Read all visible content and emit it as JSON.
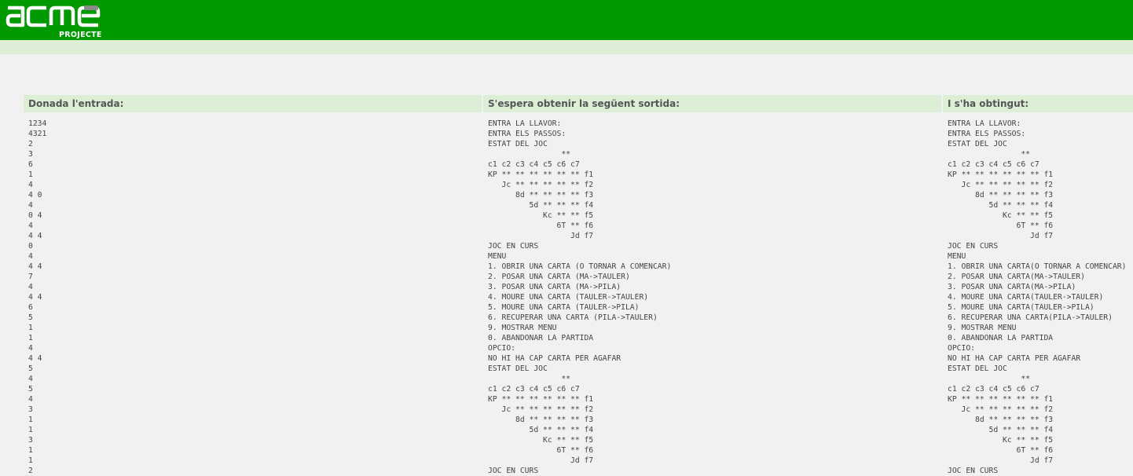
{
  "header": {
    "logo_text": "acme",
    "logo_subtitle": "PROJECTE"
  },
  "columns": {
    "input": {
      "title": "Donada l'entrada:",
      "lines": [
        "1234",
        "4321",
        "2",
        "3",
        "6",
        "1",
        "4",
        "4 0",
        "4",
        "0 4",
        "4",
        "4 4",
        "0",
        "4",
        "4 4",
        "7",
        "4",
        "4 4",
        "6",
        "5",
        "1",
        "1",
        "4",
        "4 4",
        "5",
        "4",
        "5",
        "4",
        "3",
        "1",
        "1",
        "3",
        "1",
        "1",
        "2"
      ]
    },
    "expected": {
      "title": "S'espera obtenir la següent sortida:",
      "lines": [
        "ENTRA LA LLAVOR:",
        "ENTRA ELS PASSOS:",
        "ESTAT DEL JOC",
        "                **",
        "c1 c2 c3 c4 c5 c6 c7",
        "KP ** ** ** ** ** ** f1",
        "   Jc ** ** ** ** ** f2",
        "      8d ** ** ** ** f3",
        "         5d ** ** ** f4",
        "            Kc ** ** f5",
        "               6T ** f6",
        "                  Jd f7",
        "JOC EN CURS",
        "MENU",
        "1. OBRIR UNA CARTA (O TORNAR A COMENCAR)",
        "2. POSAR UNA CARTA (MA->TAULER)",
        "3. POSAR UNA CARTA (MA->PILA)",
        "4. MOURE UNA CARTA (TAULER->TAULER)",
        "5. MOURE UNA CARTA (TAULER->PILA)",
        "6. RECUPERAR UNA CARTA (PILA->TAULER)",
        "9. MOSTRAR MENU",
        "0. ABANDONAR LA PARTIDA",
        "OPCIO:",
        "NO HI HA CAP CARTA PER AGAFAR",
        "ESTAT DEL JOC",
        "                **",
        "c1 c2 c3 c4 c5 c6 c7",
        "KP ** ** ** ** ** ** f1",
        "   Jc ** ** ** ** ** f2",
        "      8d ** ** ** ** f3",
        "         5d ** ** ** f4",
        "            Kc ** ** f5",
        "               6T ** f6",
        "                  Jd f7",
        "JOC EN CURS"
      ]
    },
    "obtained": {
      "title": "I s'ha obtingut:",
      "lines": [
        "ENTRA LA LLAVOR:",
        "ENTRA ELS PASSOS:",
        "ESTAT DEL JOC",
        "                **",
        "c1 c2 c3 c4 c5 c6 c7",
        "KP ** ** ** ** ** ** f1",
        "   Jc ** ** ** ** ** f2",
        "      8d ** ** ** ** f3",
        "         5d ** ** ** f4",
        "            Kc ** ** f5",
        "               6T ** f6",
        "                  Jd f7",
        "JOC EN CURS",
        "MENU",
        "1. OBRIR UNA CARTA(O TORNAR A COMENCAR)",
        "2. POSAR UNA CARTA(MA->TAULER)",
        "3. POSAR UNA CARTA(MA->PILA)",
        "4. MOURE UNA CARTA(TAULER->TAULER)",
        "5. MOURE UNA CARTA(TAULER->PILA)",
        "6. RECUPERAR UNA CARTA(PILA->TAULER)",
        "9. MOSTRAR MENU",
        "0. ABANDONAR LA PARTIDA",
        "OPCIO:",
        "NO HI HA CAP CARTA PER AGAFAR",
        "ESTAT DEL JOC",
        "                **",
        "c1 c2 c3 c4 c5 c6 c7",
        "KP ** ** ** ** ** ** f1",
        "   Jc ** ** ** ** ** f2",
        "      8d ** ** ** ** f3",
        "         5d ** ** ** f4",
        "            Kc ** ** f5",
        "               6T ** f6",
        "                  Jd f7",
        "JOC EN CURS"
      ]
    }
  }
}
